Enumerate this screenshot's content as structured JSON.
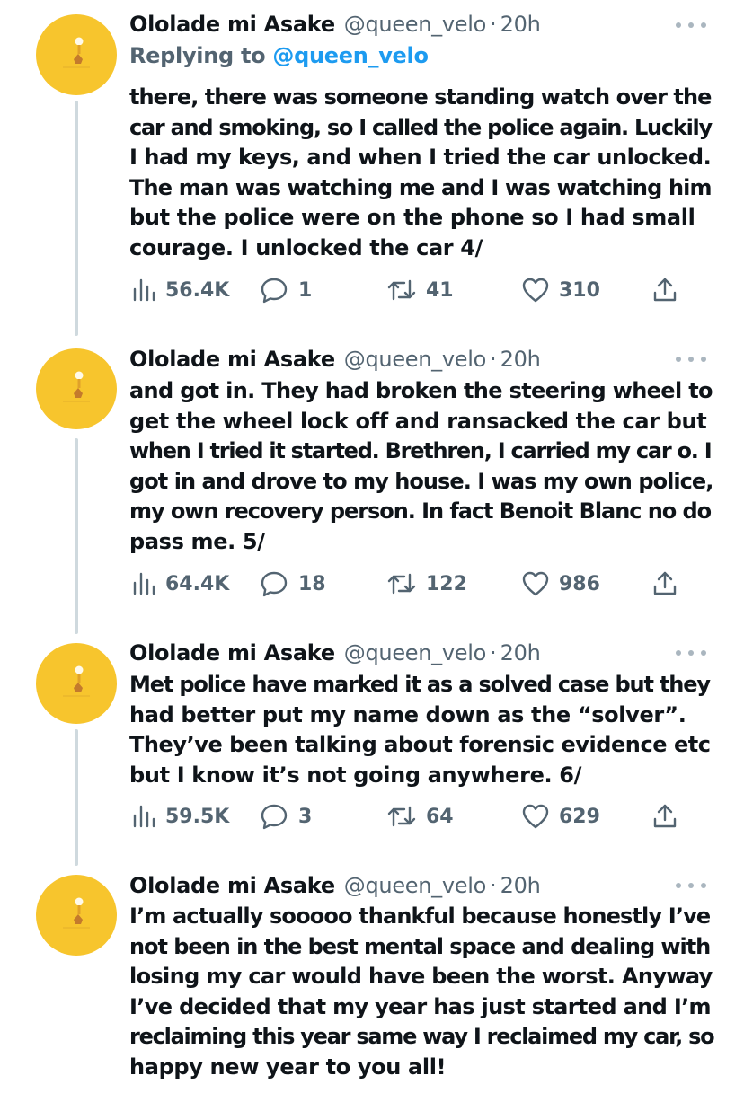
{
  "colors": {
    "avatar_bg": "#f7c52d",
    "text": "#0f1419",
    "muted": "#536471",
    "link": "#1d9bf0",
    "thread_line": "#cfd9de"
  },
  "tweets": [
    {
      "name": "Ololade mi Asake",
      "handle": "@queen_velo",
      "separator": "·",
      "time": "20h",
      "reply_prefix": "Replying to",
      "reply_mention": "@queen_velo",
      "lines": [
        "there, there was someone standing watch over the",
        "car and smoking, so I called the police again. Luckily",
        "I had my keys, and when I tried the car unlocked.",
        "The man was watching me and I was watching him",
        "but the police were on the phone so I had small",
        "courage. I unlocked the car 4/"
      ],
      "views": "56.4K",
      "replies": "1",
      "retweets": "41",
      "likes": "310"
    },
    {
      "name": "Ololade mi Asake",
      "handle": "@queen_velo",
      "separator": "·",
      "time": "20h",
      "lines": [
        "and got in. They had broken the steering wheel to",
        "get the wheel lock off and ransacked the car but",
        "when I tried it started. Brethren, I carried my car o. I",
        "got in and drove to my house. I was my own police,",
        "my own recovery person. In fact Benoit Blanc no do",
        "pass me. 5/"
      ],
      "views": "64.4K",
      "replies": "18",
      "retweets": "122",
      "likes": "986"
    },
    {
      "name": "Ololade mi Asake",
      "handle": "@queen_velo",
      "separator": "·",
      "time": "20h",
      "lines": [
        "Met police have marked it as a solved case but they",
        "had better put my name down as the “solver”.",
        "They’ve been talking about forensic evidence etc",
        "but I know it’s not going anywhere. 6/"
      ],
      "views": "59.5K",
      "replies": "3",
      "retweets": "64",
      "likes": "629"
    },
    {
      "name": "Ololade mi Asake",
      "handle": "@queen_velo",
      "separator": "·",
      "time": "20h",
      "lines": [
        "I’m actually sooooo thankful because honestly I’ve",
        "not been in the best mental space and dealing with",
        "losing my car would have been the worst. Anyway",
        "I’ve decided that my year has just started and I’m",
        "reclaiming this year same way I reclaimed my car, so",
        "happy new year to you all!"
      ]
    }
  ]
}
